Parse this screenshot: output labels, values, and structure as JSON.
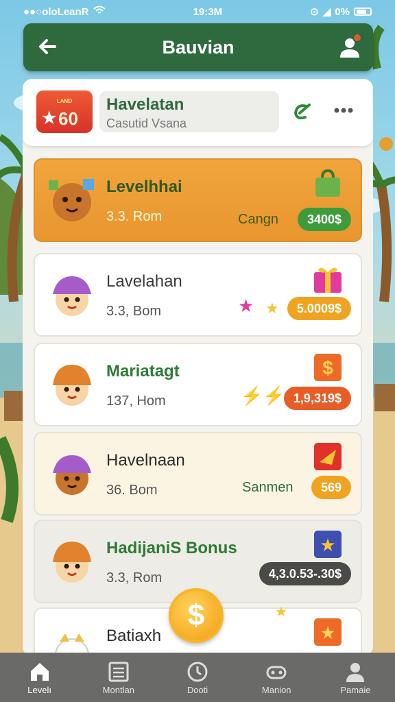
{
  "status_bar": {
    "carrier": "●●○oloLeanR",
    "time": "19:3M",
    "battery": "0%"
  },
  "header": {
    "title": "Bauvian"
  },
  "profile_card": {
    "badge_small": "ᴸᴬᴹᴰ",
    "badge_big": "60",
    "name": "Havelatan",
    "subtitle": "Casutid Vsana"
  },
  "rows": [
    {
      "title": "Levelhhai",
      "subtitle": "3.3. Rom",
      "reward_label": "Cangn",
      "amount": "3400$"
    },
    {
      "title": "Lavelahan",
      "subtitle": "3.3, Bom",
      "reward_label": "",
      "amount": "5.0009$"
    },
    {
      "title": "Mariatagt",
      "subtitle": "137, Hom",
      "reward_label": "",
      "amount": "1,9,319$"
    },
    {
      "title": "Havelnaan",
      "subtitle": "36. Bom",
      "reward_label": "Sanmen",
      "amount": "569"
    },
    {
      "title": "HadijaniS Bonus",
      "subtitle": "3.3, Rom",
      "reward_label": "",
      "amount": "4,3.0.53-.30$"
    },
    {
      "title": "Batiaxh",
      "subtitle": "",
      "reward_label": "",
      "amount": ""
    }
  ],
  "coin_fab": {
    "symbol": "$"
  },
  "bottom_nav": [
    {
      "label": "Levelı"
    },
    {
      "label": "Montlan"
    },
    {
      "label": "Dooti"
    },
    {
      "label": "Manion"
    },
    {
      "label": "Pamaie"
    }
  ],
  "colors": {
    "header": "#2f6a3f",
    "highlight_row": "#f1a53c",
    "accent_green": "#3d9b3a",
    "nav_bg": "#6a6a68"
  }
}
